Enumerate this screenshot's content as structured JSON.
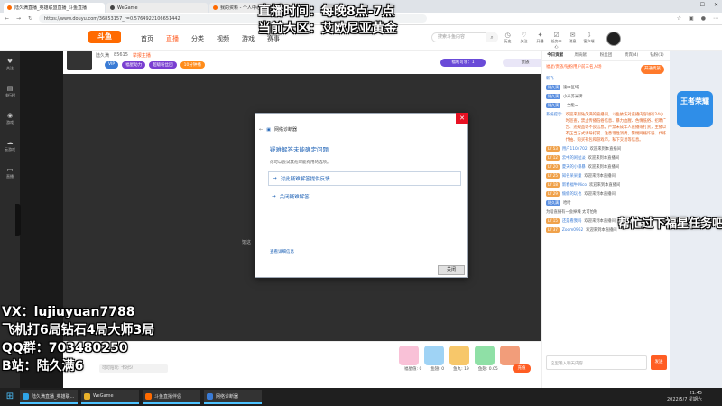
{
  "browser": {
    "tabs": [
      {
        "label": "陆久满直播_英雄联盟直播_斗鱼直播"
      },
      {
        "label": "WeGame"
      },
      {
        "label": "我的资料 - 个人中心 - 斗鱼"
      }
    ],
    "url": "https://www.douyu.com/36853157_r=0.5764922106651442"
  },
  "site": {
    "logo": "斗鱼",
    "nav": [
      "首页",
      "直播",
      "分类",
      "视频",
      "游戏",
      "赛事"
    ],
    "search_placeholder": "搜索斗鱼内容",
    "header_icons": [
      {
        "icon": "history-icon",
        "label": "历史"
      },
      {
        "icon": "follow-icon",
        "label": "关注"
      },
      {
        "icon": "star-icon",
        "label": "开播"
      },
      {
        "icon": "task-icon",
        "label": "任务中心"
      },
      {
        "icon": "message-icon",
        "label": "消息"
      },
      {
        "icon": "download-icon",
        "label": "客户端"
      }
    ]
  },
  "overlay": {
    "top1": "直播时间：每晚8点-7点",
    "top2": "当前大区：艾欧尼亚黄金",
    "vx": "VX：lujiuyuan7788",
    "rank": "飞机打6局钻石4局大师3局",
    "qq": "QQ群：703480250",
    "bili": "B站：陆久满6",
    "mid": "帮忙过下福星任务吧"
  },
  "left_sidebar": {
    "items": [
      "关注",
      "排行榜",
      "游戏",
      "云游戏",
      "直播"
    ]
  },
  "room": {
    "line1": [
      "陆久满",
      "85615",
      "举报主播"
    ],
    "tags": [
      "VIP",
      "福星助力",
      "超级粉丝团",
      "10分钟播"
    ],
    "power_label": "福利可领：1",
    "noble_label": "贵族"
  },
  "dialog": {
    "title": "网络诊断器",
    "heading": "疑难解答未能确定问题",
    "subtitle": "你可以尝试其他可能有用的选项。",
    "option1": "对此疑难解答提供反馈",
    "option2": "关闭疑难解答",
    "detail_link": "查看详细信息",
    "close_button": "关闭"
  },
  "video": {
    "mid_text": "馆这"
  },
  "gift_bar": {
    "input_placeholder": "可可陪玩: 卡对5!",
    "gift_info": [
      "福星值: 0",
      "鱼翅: 0",
      "鱼丸: 19",
      "鱼翅: 0.05"
    ],
    "recharge": "充值"
  },
  "right_panel": {
    "tabs": [
      "今日贡献",
      "周贡献",
      "粉丝团",
      "贵宾(4)",
      "钻粉(1)"
    ],
    "rank_note": "福星/贵族/钻粉用户前三名入场",
    "open_btn": "开通贵族",
    "chat": [
      {
        "lv": "",
        "badge": "",
        "name": "新飞~",
        "text": ""
      },
      {
        "lv": "",
        "badge": "陆久满",
        "name": "",
        "text": "速中区域"
      },
      {
        "lv": "",
        "badge": "陆久满",
        "name": "",
        "text": "小米苏米牌"
      },
      {
        "lv": "",
        "badge": "陆久满",
        "name": "",
        "text": "...全能~"
      },
      {
        "lv": "",
        "badge": "",
        "name": "系统提示:",
        "text": "欢迎来到陆久满的直播间，斗鱼依法对直播内容进行24小时巡查，禁止传播低俗信息、暴力血腥、色情低俗、招聘广告、违规品等不良信息。严禁未成年人直播或打赏，主播以不正当方式诱导打赏、注意理性消费，警惕网络诈骗、代练代抽、购买礼包和游戏币，私下交易等信息。",
        "sys": true
      },
      {
        "lv": "LV 53",
        "badge": "",
        "name": "用户1104702",
        "text": "欢迎来到本直播间"
      },
      {
        "lv": "LV 12",
        "badge": "",
        "name": "云中的闲扯淡",
        "text": "欢迎来到本直播间"
      },
      {
        "lv": "LV 20",
        "badge": "",
        "name": "夏天的小暴暴",
        "text": "欢迎来到本直播间"
      },
      {
        "lv": "LV 25",
        "badge": "",
        "name": "知名呆呆童",
        "text": "欢迎来到本直播间"
      },
      {
        "lv": "LV 18",
        "badge": "",
        "name": "新春福牛Mico",
        "text": "欢迎来到本直播间"
      },
      {
        "lv": "LV 29",
        "badge": "",
        "name": "偷偷的玩也",
        "text": "欢迎来到本直播间"
      },
      {
        "lv": "",
        "badge": "陆久满",
        "name": "",
        "text": "哈哈"
      },
      {
        "lv": "",
        "badge": "",
        "name": "",
        "text": "为啥直播有一会掉线 太可怕啦"
      },
      {
        "lv": "LV 15",
        "badge": "",
        "name": "还是看我吗",
        "text": "欢迎来到本直播间"
      },
      {
        "lv": "LV 37",
        "badge": "",
        "name": "Zoom0962",
        "text": "欢迎来到本直播间"
      }
    ],
    "input_placeholder": "这里输入聊天内容",
    "send_btn": "发送"
  },
  "promo": {
    "text": "王者荣耀"
  },
  "taskbar": {
    "items": [
      "陆久满直播_英雄联...",
      "WeGame",
      "斗鱼直播伴侣",
      "网络诊断器"
    ],
    "time": "21:45",
    "date": "2022/5/7 星期六"
  }
}
